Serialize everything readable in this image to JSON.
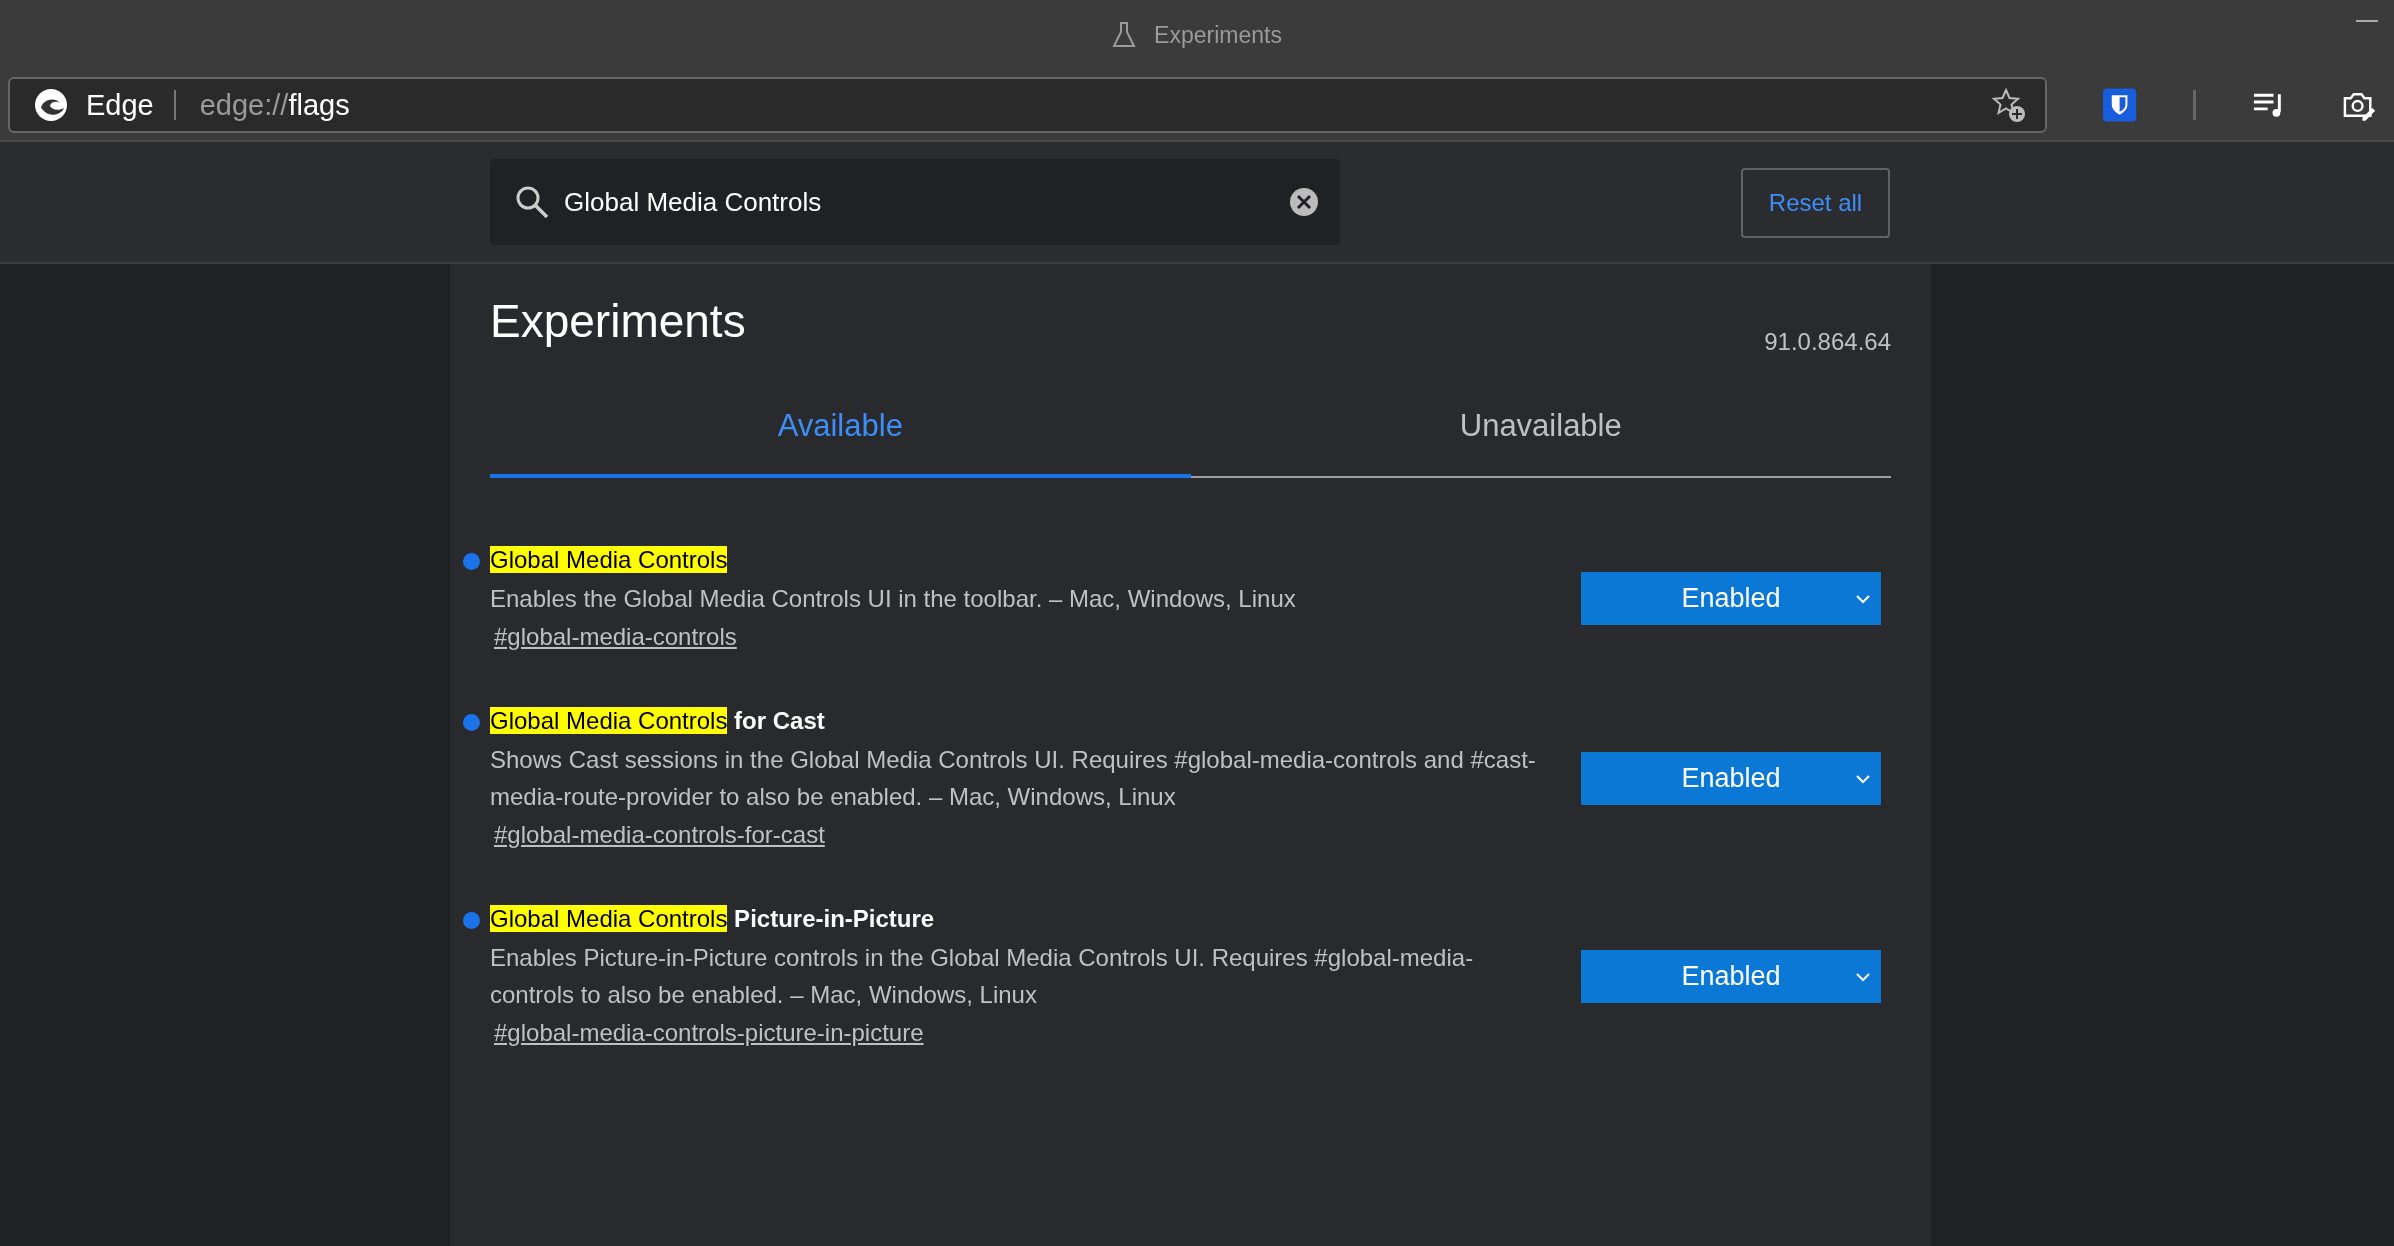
{
  "window": {
    "title": "Experiments"
  },
  "toolbar": {
    "site_label": "Edge",
    "url_scheme": "edge://",
    "url_path": "flags"
  },
  "search": {
    "value": "Global Media Controls"
  },
  "reset_button": "Reset all",
  "page": {
    "heading": "Experiments",
    "version": "91.0.864.64"
  },
  "tabs": [
    {
      "label": "Available",
      "selected": true
    },
    {
      "label": "Unavailable",
      "selected": false
    }
  ],
  "flags": [
    {
      "title_match": "Global Media Controls",
      "description": "Enables the Global Media Controls UI in the toolbar. – Mac, Windows, Linux",
      "link": "#global-media-controls",
      "modified": true,
      "value": "Enabled"
    },
    {
      "title_match": "Global Media Controls",
      "title_rest": "for Cast",
      "description": "Shows Cast sessions in the Global Media Controls UI. Requires #global-media-controls and #cast-media-route-provider to also be enabled. – Mac, Windows, Linux",
      "link": "#global-media-controls-for-cast",
      "modified": true,
      "value": "Enabled"
    },
    {
      "title_match": "Global Media Controls",
      "title_rest": "Picture-in-Picture",
      "description": "Enables Picture-in-Picture controls in the Global Media Controls UI. Requires #global-media-controls to also be enabled. – Mac, Windows, Linux",
      "link": "#global-media-controls-picture-in-picture",
      "modified": true,
      "value": "Enabled"
    }
  ]
}
